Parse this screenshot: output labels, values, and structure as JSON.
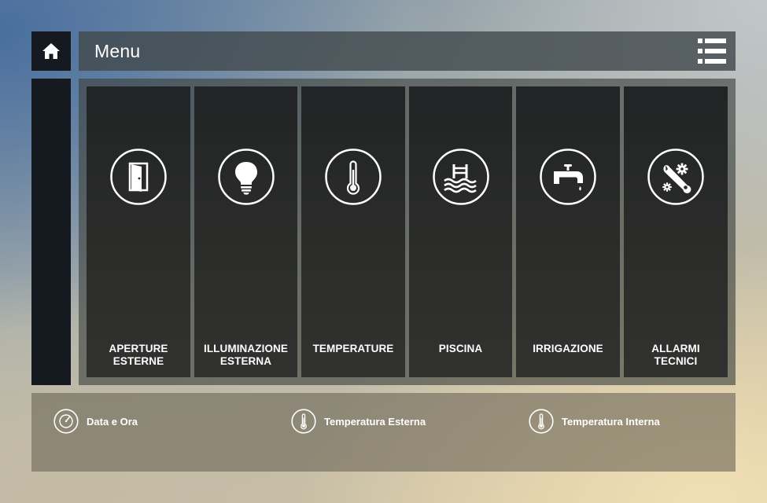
{
  "header": {
    "home_icon": "home-icon",
    "title": "Menu",
    "list_icon": "list-view-icon"
  },
  "tiles": [
    {
      "label": "APERTURE\nESTERNE",
      "icon": "door-icon"
    },
    {
      "label": "ILLUMINAZIONE\nESTERNA",
      "icon": "lightbulb-icon"
    },
    {
      "label": "TEMPERATURE",
      "icon": "thermometer-icon"
    },
    {
      "label": "PISCINA",
      "icon": "pool-icon"
    },
    {
      "label": "IRRIGAZIONE",
      "icon": "faucet-icon"
    },
    {
      "label": "ALLARMI\nTECNICI",
      "icon": "wrench-gears-icon"
    }
  ],
  "info": [
    {
      "label": "Data e Ora",
      "icon": "clock-icon"
    },
    {
      "label": "Temperatura Esterna",
      "icon": "thermometer-icon"
    },
    {
      "label": "Temperatura Interna",
      "icon": "thermometer-icon"
    }
  ],
  "colors": {
    "dark_panel": "#141a20",
    "tile_bg": "#282a29",
    "text": "#ffffff"
  }
}
